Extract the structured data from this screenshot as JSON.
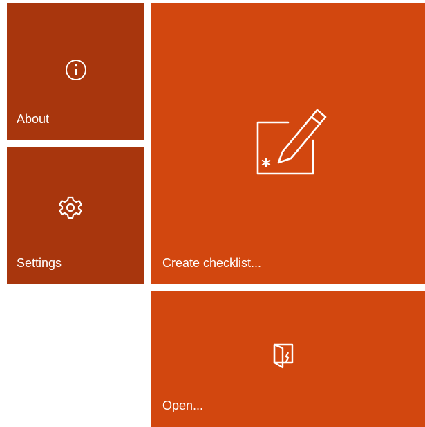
{
  "colors": {
    "tile_dark": "#a8360d",
    "tile_light": "#d2470f",
    "text": "#ffffff",
    "background": "#ffffff"
  },
  "tiles": {
    "about": {
      "label": "About",
      "icon": "info-icon"
    },
    "settings": {
      "label": "Settings",
      "icon": "gear-icon"
    },
    "create_checklist": {
      "label": "Create checklist...",
      "icon": "edit-new-icon"
    },
    "open": {
      "label": "Open...",
      "icon": "open-door-icon"
    }
  }
}
